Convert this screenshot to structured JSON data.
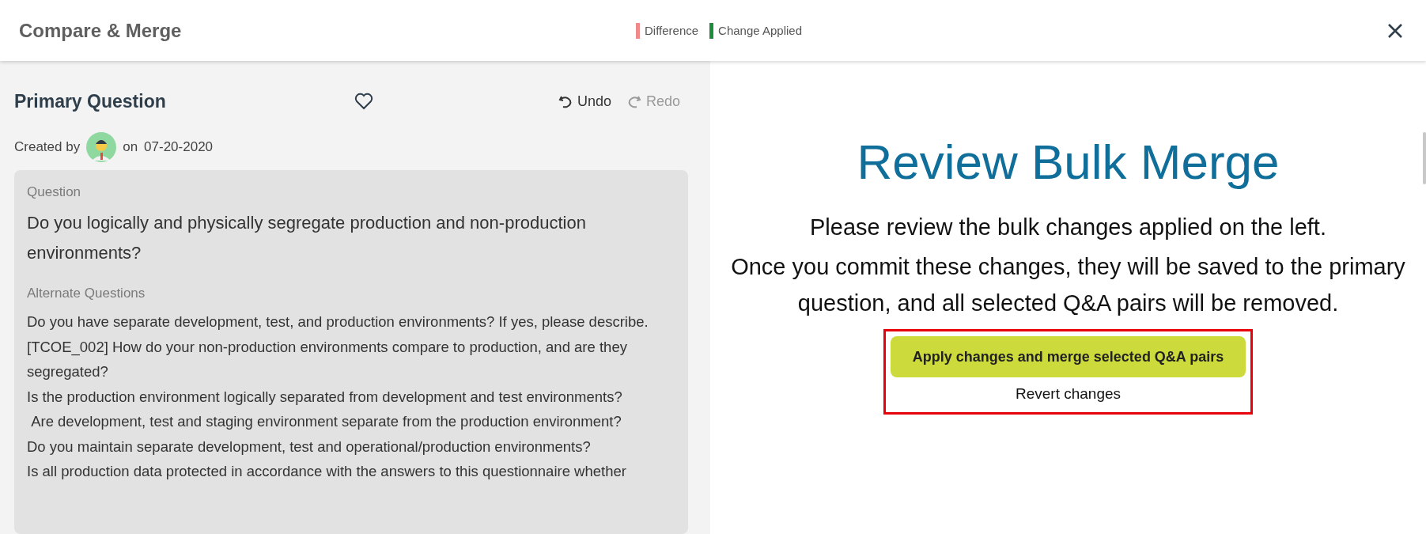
{
  "header": {
    "title": "Compare & Merge",
    "legend": [
      {
        "label": "Difference",
        "color": "#f08a8a"
      },
      {
        "label": "Change Applied",
        "color": "#1e8a3c"
      }
    ]
  },
  "left_panel": {
    "title": "Primary Question",
    "undo": {
      "label": "Undo",
      "disabled": false
    },
    "redo": {
      "label": "Redo",
      "disabled": true
    },
    "created_by_label": "Created by",
    "created_on_label": "on",
    "created_date": "07-20-2020",
    "question_label": "Question",
    "question": "Do you logically and physically segregate production and non-production environments?",
    "alternates_label": "Alternate Questions",
    "alternates": [
      "Do you have separate development, test, and production environments? If yes, please describe.",
      "[TCOE_002] How do your non-production environments compare to production, and are they segregated?",
      "Is the production environment logically separated from development and test environments?",
      " Are development, test and staging environment separate from the production environment?",
      "Do you maintain separate development, test and operational/production environments?",
      "Is all production data protected in accordance with the answers to this questionnaire whether"
    ]
  },
  "right_panel": {
    "title": "Review Bulk Merge",
    "lines": [
      "Please review the bulk changes applied on the left.",
      "Once you commit these changes, they will be saved to the primary question, and all selected Q&A pairs will be removed."
    ],
    "apply_button": "Apply changes and merge selected Q&A pairs",
    "revert_button": "Revert changes"
  }
}
